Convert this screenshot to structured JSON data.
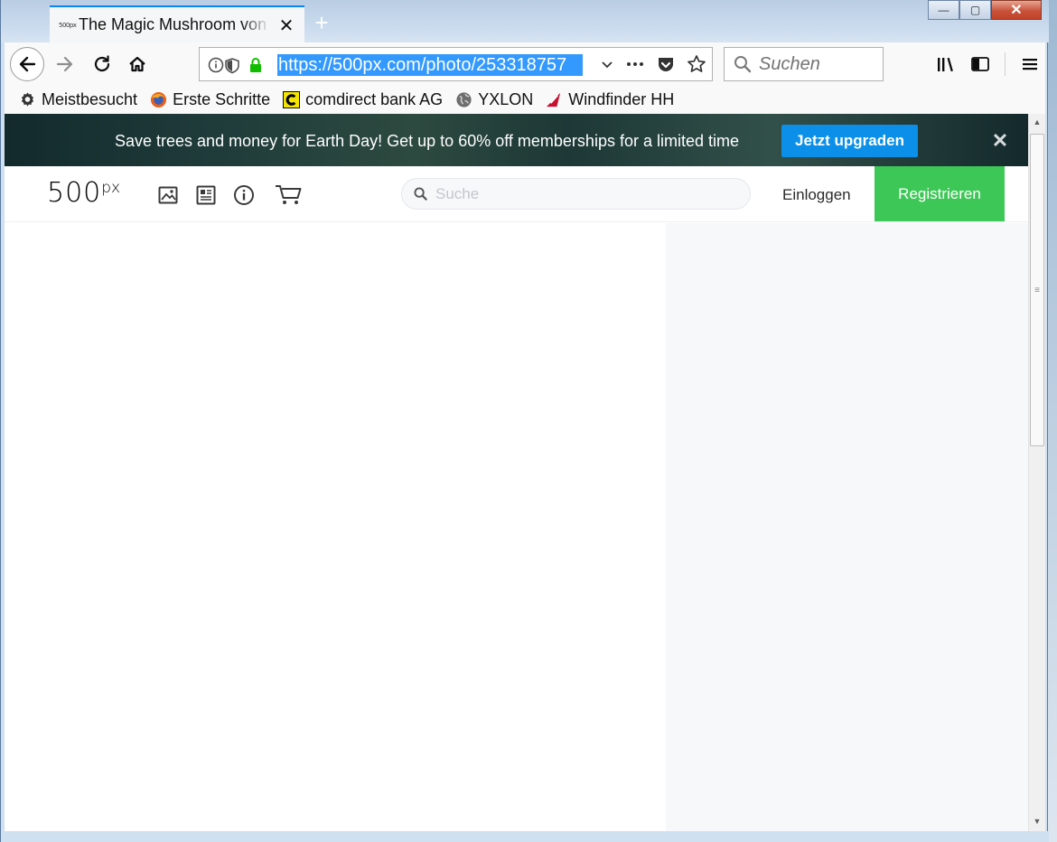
{
  "browser": {
    "tab": {
      "favicon_text": "500px",
      "title": "The Magic Mushroom von",
      "close_label": "✕"
    },
    "new_tab_label": "+",
    "window_controls": {
      "minimize": "—",
      "maximize": "▢",
      "close": "✕"
    },
    "url": "https://500px.com/photo/253318757",
    "search_placeholder": "Suchen",
    "bookmarks": [
      {
        "label": "Meistbesucht",
        "icon": "gear-icon"
      },
      {
        "label": "Erste Schritte",
        "icon": "firefox-icon"
      },
      {
        "label": "comdirect bank AG",
        "icon": "comdirect-icon"
      },
      {
        "label": "YXLON",
        "icon": "globe-icon"
      },
      {
        "label": "Windfinder HH",
        "icon": "windfinder-icon"
      }
    ]
  },
  "promo": {
    "text": "Save trees and money for Earth Day! Get up to 60% off memberships for a limited time",
    "button_label": "Jetzt upgraden",
    "close_label": "✕"
  },
  "site": {
    "logo": "500",
    "logo_sup": "px",
    "search_placeholder": "Suche",
    "login_label": "Einloggen",
    "register_label": "Registrieren"
  },
  "colors": {
    "register_green": "#3dc756",
    "promo_button_blue": "#0b8fe8",
    "url_selection": "#3399ff",
    "tab_accent": "#0a84ff"
  }
}
